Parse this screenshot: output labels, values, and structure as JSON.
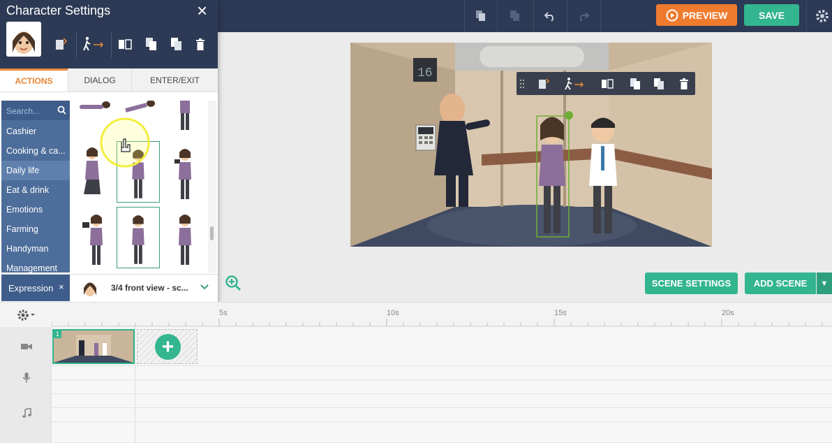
{
  "panel": {
    "title": "Character Settings",
    "close_glyph": "×",
    "tabs": [
      {
        "label": "ACTIONS",
        "active": true
      },
      {
        "label": "DIALOG",
        "active": false
      },
      {
        "label": "ENTER/EXIT",
        "active": false
      }
    ],
    "search_placeholder": "Search...",
    "categories": [
      {
        "label": "Cashier",
        "selected": false
      },
      {
        "label": "Cooking & ca...",
        "selected": false
      },
      {
        "label": "Daily life",
        "selected": true
      },
      {
        "label": "Eat & drink",
        "selected": false
      },
      {
        "label": "Emotions",
        "selected": false
      },
      {
        "label": "Farming",
        "selected": false
      },
      {
        "label": "Handyman",
        "selected": false
      },
      {
        "label": "Management",
        "selected": false
      }
    ],
    "expression": {
      "label": "Expression",
      "clear_glyph": "×",
      "value": "3/4 front view - sc...",
      "chevron": "⌄"
    }
  },
  "topbar": {
    "preview_label": "PREVIEW",
    "save_label": "SAVE"
  },
  "stage": {
    "scene_settings_label": "SCENE SETTINGS",
    "add_scene_label": "ADD SCENE"
  },
  "timeline": {
    "ruler_labels": [
      "5s",
      "10s",
      "15s",
      "20s"
    ],
    "scene_number": "1",
    "add_glyph": "+"
  },
  "colors": {
    "navy": "#2d3a55",
    "orange": "#ef7b2e",
    "green": "#33b58f",
    "category_blue": "#4d6d9a"
  }
}
